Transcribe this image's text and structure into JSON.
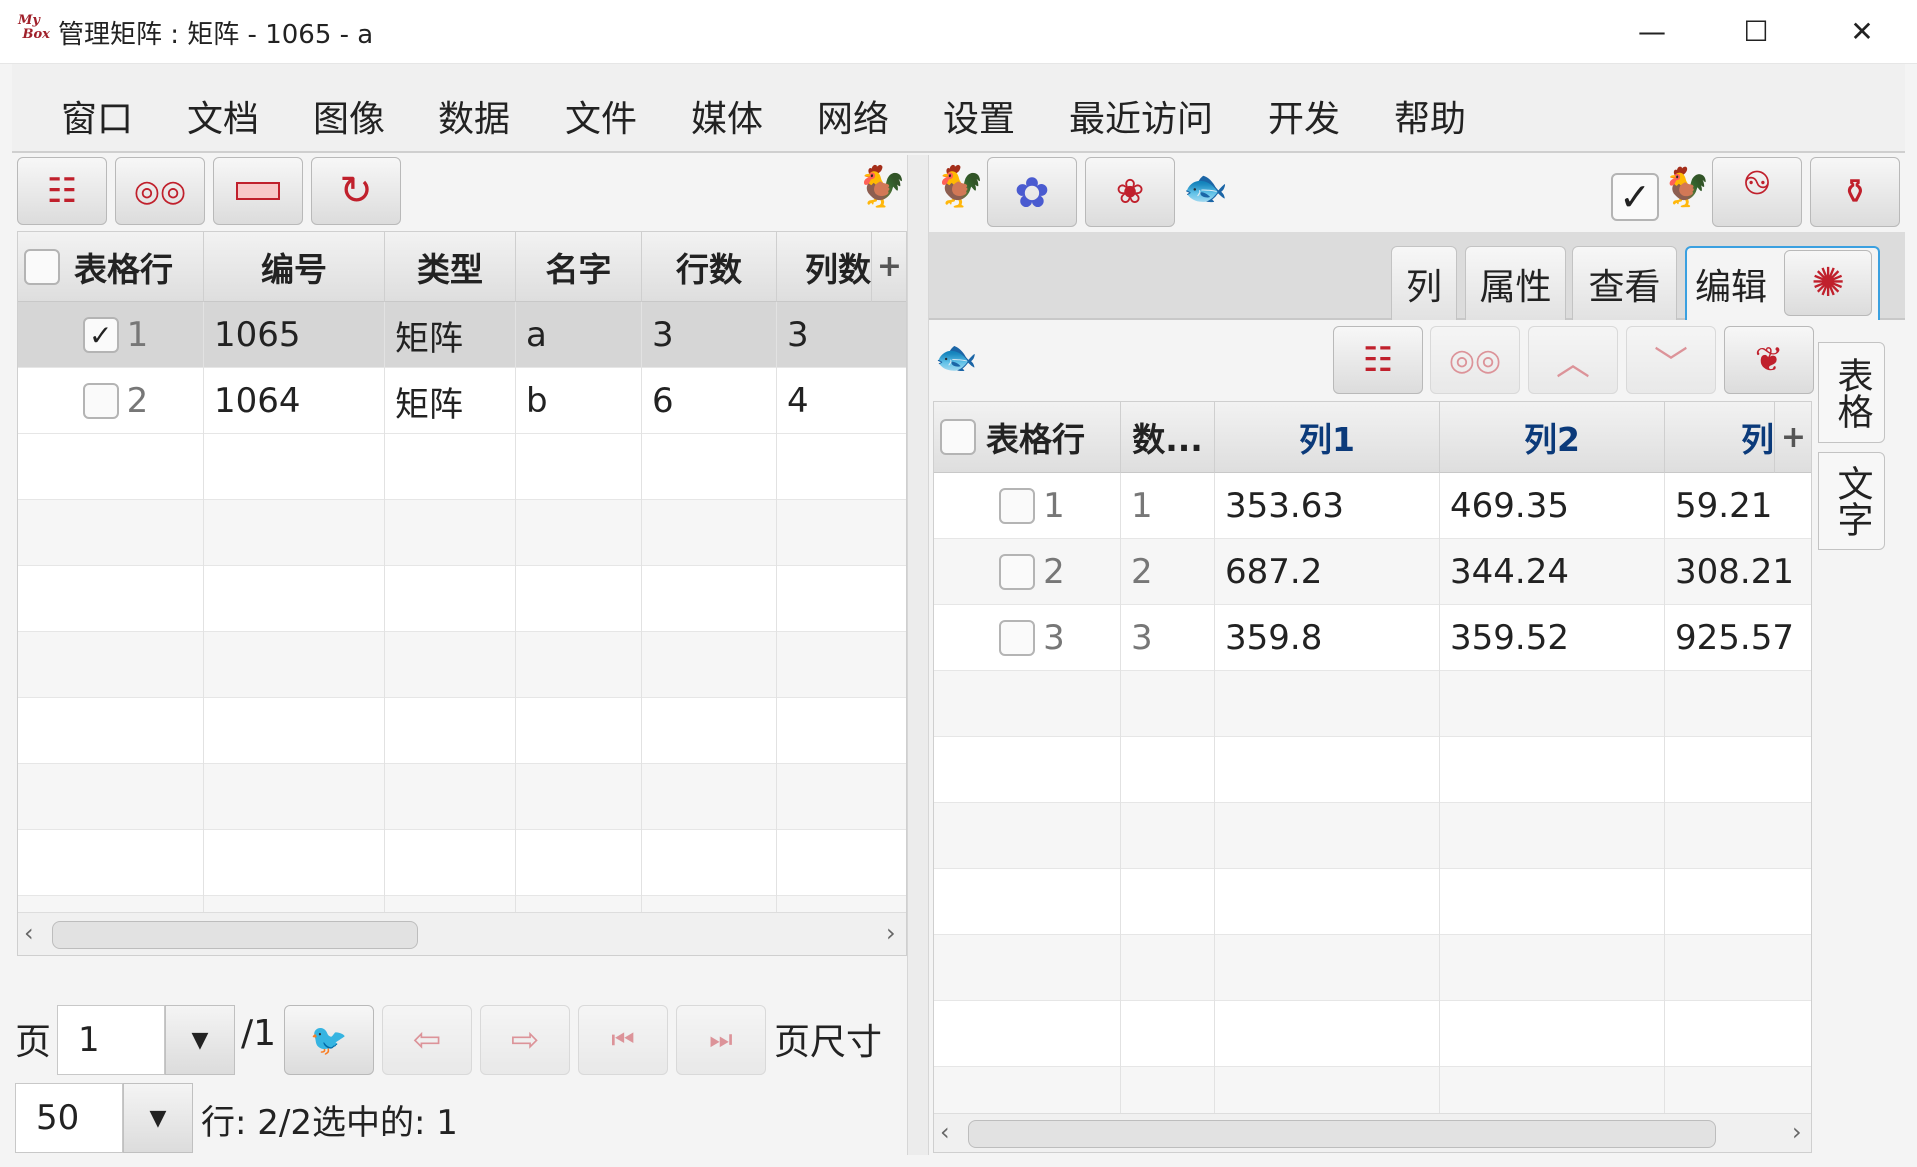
{
  "window": {
    "logo": "My Box",
    "title": "管理矩阵 : 矩阵 - 1065 - a",
    "minimize": "—",
    "maximize": "☐",
    "close": "✕"
  },
  "menu": [
    "窗口",
    "文档",
    "图像",
    "数据",
    "文件",
    "媒体",
    "网络",
    "设置",
    "最近访问",
    "开发",
    "帮助"
  ],
  "left_table": {
    "headers": [
      "表格行",
      "编号",
      "类型",
      "名字",
      "行数",
      "列数"
    ],
    "add_column": "+",
    "rows": [
      {
        "checked": true,
        "index": "1",
        "id": "1065",
        "type": "矩阵",
        "name": "a",
        "rows": "3",
        "cols": "3"
      },
      {
        "checked": false,
        "index": "2",
        "id": "1064",
        "type": "矩阵",
        "name": "b",
        "rows": "6",
        "cols": "4"
      }
    ]
  },
  "pagination": {
    "page_label": "页",
    "page_value": "1",
    "page_total": "/1",
    "page_size_label": "页尺寸",
    "page_size_value": "50",
    "status": "行: 2/2选中的: 1"
  },
  "right_tabs": [
    "列",
    "属性",
    "查看",
    "编辑"
  ],
  "side_tabs": [
    "表格",
    "文字"
  ],
  "right_table": {
    "headers": [
      "表格行",
      "数...",
      "列1",
      "列2",
      "列"
    ],
    "add_column": "+",
    "rows": [
      {
        "index": "1",
        "num": "1",
        "c1": "353.63",
        "c2": "469.35",
        "c3": "59.21"
      },
      {
        "index": "2",
        "num": "2",
        "c1": "687.2",
        "c2": "344.24",
        "c3": "308.21"
      },
      {
        "index": "3",
        "num": "3",
        "c1": "359.8",
        "c2": "359.52",
        "c3": "925.57"
      }
    ]
  },
  "colors": {
    "accent": "#c0202c",
    "column_header": "#0b3a7a",
    "gear": "#4a5bd0",
    "selected_row": "#d6d6d6",
    "tab_focus": "#3aa0e0"
  }
}
